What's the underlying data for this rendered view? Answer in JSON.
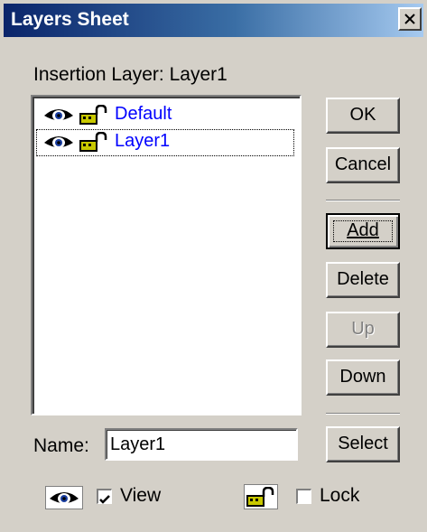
{
  "window": {
    "title": "Layers Sheet"
  },
  "insertion_layer": {
    "label": "Insertion Layer:",
    "value": "Layer1"
  },
  "layers": [
    {
      "name": "Default",
      "visible": true,
      "locked": false,
      "focused": false
    },
    {
      "name": "Layer1",
      "visible": true,
      "locked": false,
      "focused": true
    }
  ],
  "buttons": {
    "ok": "OK",
    "cancel": "Cancel",
    "add": "Add",
    "delete": "Delete",
    "up": "Up",
    "down": "Down",
    "select": "Select"
  },
  "name_field": {
    "label": "Name:",
    "value": "Layer1"
  },
  "view_checkbox": {
    "label": "View",
    "checked": true
  },
  "lock_checkbox": {
    "label": "Lock",
    "checked": false
  },
  "colors": {
    "title_start": "#0a246a",
    "title_end": "#a6caf0",
    "layer_text": "#0000ff",
    "dialog_bg": "#d4d0c8"
  },
  "icons": [
    "eye-icon",
    "lock-icon",
    "close-icon"
  ]
}
